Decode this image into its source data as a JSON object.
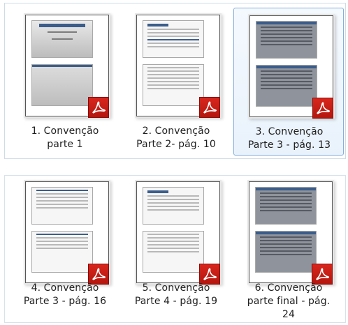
{
  "files": [
    {
      "label_line1": "1. Convenção",
      "label_line2": "parte 1",
      "label_line3": "",
      "icon": "pdf-file-icon"
    },
    {
      "label_line1": "2. Convenção",
      "label_line2": "Parte 2-  pág. 10",
      "label_line3": "",
      "icon": "pdf-file-icon"
    },
    {
      "label_line1": "3. Convenção",
      "label_line2": "Parte 3 - pág. 13",
      "label_line3": "",
      "icon": "pdf-file-icon",
      "selected": true
    },
    {
      "label_line1": "4. Convenção",
      "label_line2": "Parte 3 - pág. 16",
      "label_line3": "",
      "icon": "pdf-file-icon"
    },
    {
      "label_line1": "5. Convenção",
      "label_line2": "Parte 4 - pág. 19",
      "label_line3": "",
      "icon": "pdf-file-icon"
    },
    {
      "label_line1": "6. Convenção",
      "label_line2": "parte final - pág.",
      "label_line3": "24",
      "icon": "pdf-file-icon"
    }
  ],
  "colors": {
    "pdf_red": "#c41d14",
    "selection_border": "#84acdd",
    "panel_border": "#cfdce8"
  }
}
